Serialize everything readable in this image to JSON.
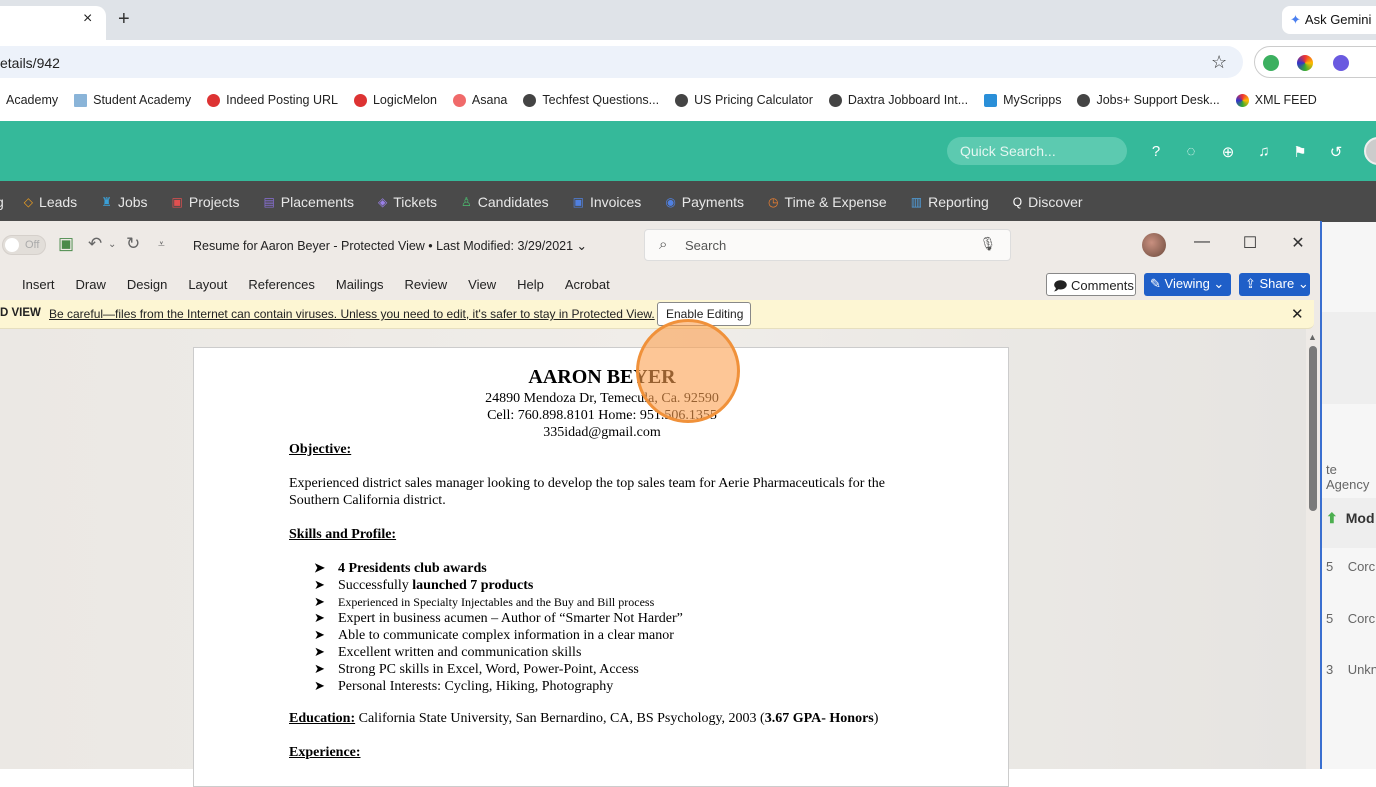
{
  "browser": {
    "tab_close": "×",
    "new_tab": "+",
    "gemini": "Ask Gemini",
    "url": "etails/942",
    "bookmarks": [
      "Academy",
      "Student Academy",
      "Indeed Posting URL",
      "LogicMelon",
      "Asana",
      "Techfest Questions...",
      "US Pricing Calculator",
      "Daxtra Jobboard Int...",
      "MyScripps",
      "Jobs+ Support Desk...",
      "XML FEED"
    ]
  },
  "app": {
    "quick_search_placeholder": "Quick Search...",
    "nav": [
      {
        "label": "Leads",
        "icon": "◇",
        "color": "#f0a020"
      },
      {
        "label": "Jobs",
        "icon": "♜",
        "color": "#3aa0d8"
      },
      {
        "label": "Projects",
        "icon": "▣",
        "color": "#e05050"
      },
      {
        "label": "Placements",
        "icon": "▤",
        "color": "#8a70d8"
      },
      {
        "label": "Tickets",
        "icon": "◈",
        "color": "#9a80e8"
      },
      {
        "label": "Candidates",
        "icon": "♙",
        "color": "#4cc070"
      },
      {
        "label": "Invoices",
        "icon": "▣",
        "color": "#5080e0"
      },
      {
        "label": "Payments",
        "icon": "◉",
        "color": "#5080e0"
      },
      {
        "label": "Time & Expense",
        "icon": "◷",
        "color": "#f08030"
      },
      {
        "label": "Reporting",
        "icon": "▥",
        "color": "#50a0e0"
      },
      {
        "label": "Discover",
        "icon": "Q",
        "color": "#ffffff"
      }
    ],
    "behind": {
      "agency": "te Agency",
      "col": "Mod",
      "rows": [
        {
          "n": "5",
          "v": "Corc"
        },
        {
          "n": "5",
          "v": "Corc"
        },
        {
          "n": "3",
          "v": "Unkn"
        }
      ]
    }
  },
  "word": {
    "autosave": "Off",
    "title": "Resume for Aaron Beyer  -  Protected View  •  Last Modified: 3/29/2021 ⌄",
    "search_placeholder": "Search",
    "ribbon": [
      "Insert",
      "Draw",
      "Design",
      "Layout",
      "References",
      "Mailings",
      "Review",
      "View",
      "Help",
      "Acrobat"
    ],
    "comments": "Comments",
    "viewing": "Viewing",
    "share": "Share",
    "protected_label": "D VIEW",
    "protected_msg": "Be careful—files from the Internet can contain viruses. Unless you need to edit, it's safer to stay in Protected View.",
    "enable_editing": "Enable Editing"
  },
  "resume": {
    "name": "AARON BEYER",
    "address": "24890 Mendoza Dr, Temecula, Ca. 92590",
    "phones": "Cell: 760.898.8101 Home: 951.506.1355",
    "email": "335idad@gmail.com",
    "objective_h": "Objective:",
    "objective_1": "Experienced district sales manager looking to develop the top sales team for Aerie Pharmaceuticals for the",
    "objective_2": "Southern California district.",
    "skills_h": "Skills and Profile:",
    "skills": [
      "4 Presidents club awards",
      "launched 7 products",
      "Experienced in Specialty Injectables and the Buy and Bill process",
      "Expert in business acumen – Author of “Smarter Not Harder”",
      "Able to communicate complex information in a clear manor",
      "Excellent written and communication skills",
      "Strong PC skills in Excel, Word, Power-Point, Access",
      "Personal Interests: Cycling, Hiking, Photography"
    ],
    "skill2_prefix": "Successfully ",
    "education_h": "Education:",
    "education": " California State University, San Bernardino, CA, BS Psychology, 2003 (",
    "education_bold": "3.67 GPA- Honors",
    "education_end": ")",
    "experience_h": "Experience:"
  }
}
